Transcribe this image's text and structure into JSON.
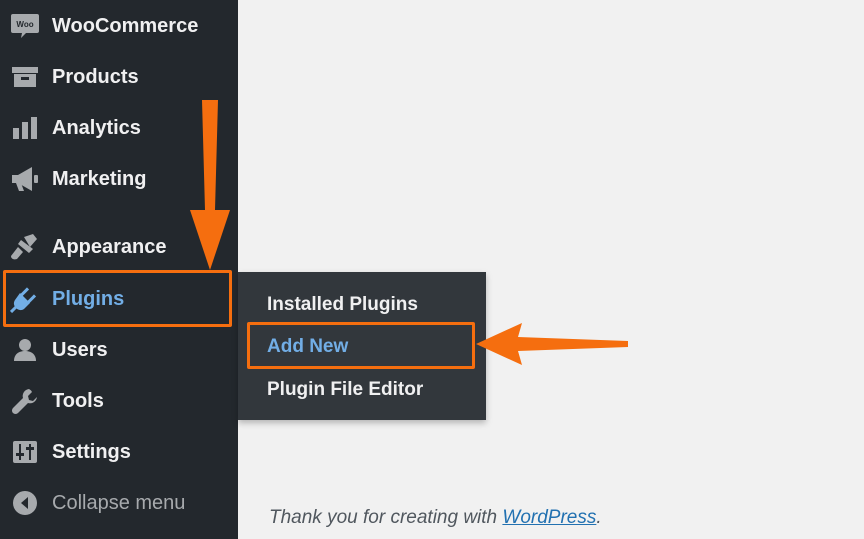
{
  "sidebar": {
    "items": [
      {
        "label": "WooCommerce",
        "icon": "woo-icon"
      },
      {
        "label": "Products",
        "icon": "archive-icon"
      },
      {
        "label": "Analytics",
        "icon": "bar-chart-icon"
      },
      {
        "label": "Marketing",
        "icon": "megaphone-icon"
      },
      {
        "label": "Appearance",
        "icon": "paintbrush-icon"
      },
      {
        "label": "Plugins",
        "icon": "plugin-icon",
        "active": true
      },
      {
        "label": "Users",
        "icon": "user-icon"
      },
      {
        "label": "Tools",
        "icon": "wrench-icon"
      },
      {
        "label": "Settings",
        "icon": "sliders-icon"
      },
      {
        "label": "Collapse menu",
        "icon": "collapse-arrow-icon"
      }
    ],
    "woo_icon_text": "Woo"
  },
  "plugins_submenu": {
    "items": [
      {
        "label": "Installed Plugins"
      },
      {
        "label": "Add New",
        "current": true
      },
      {
        "label": "Plugin File Editor"
      }
    ]
  },
  "footer": {
    "text_before": "Thank you for creating with ",
    "link_text": "WordPress",
    "text_after": "."
  },
  "colors": {
    "sidebar_bg": "#23282d",
    "flyout_bg": "#32373c",
    "active_blue": "#72aee6",
    "annotation_orange": "#f56e0f",
    "content_bg": "#f1f1f1"
  }
}
